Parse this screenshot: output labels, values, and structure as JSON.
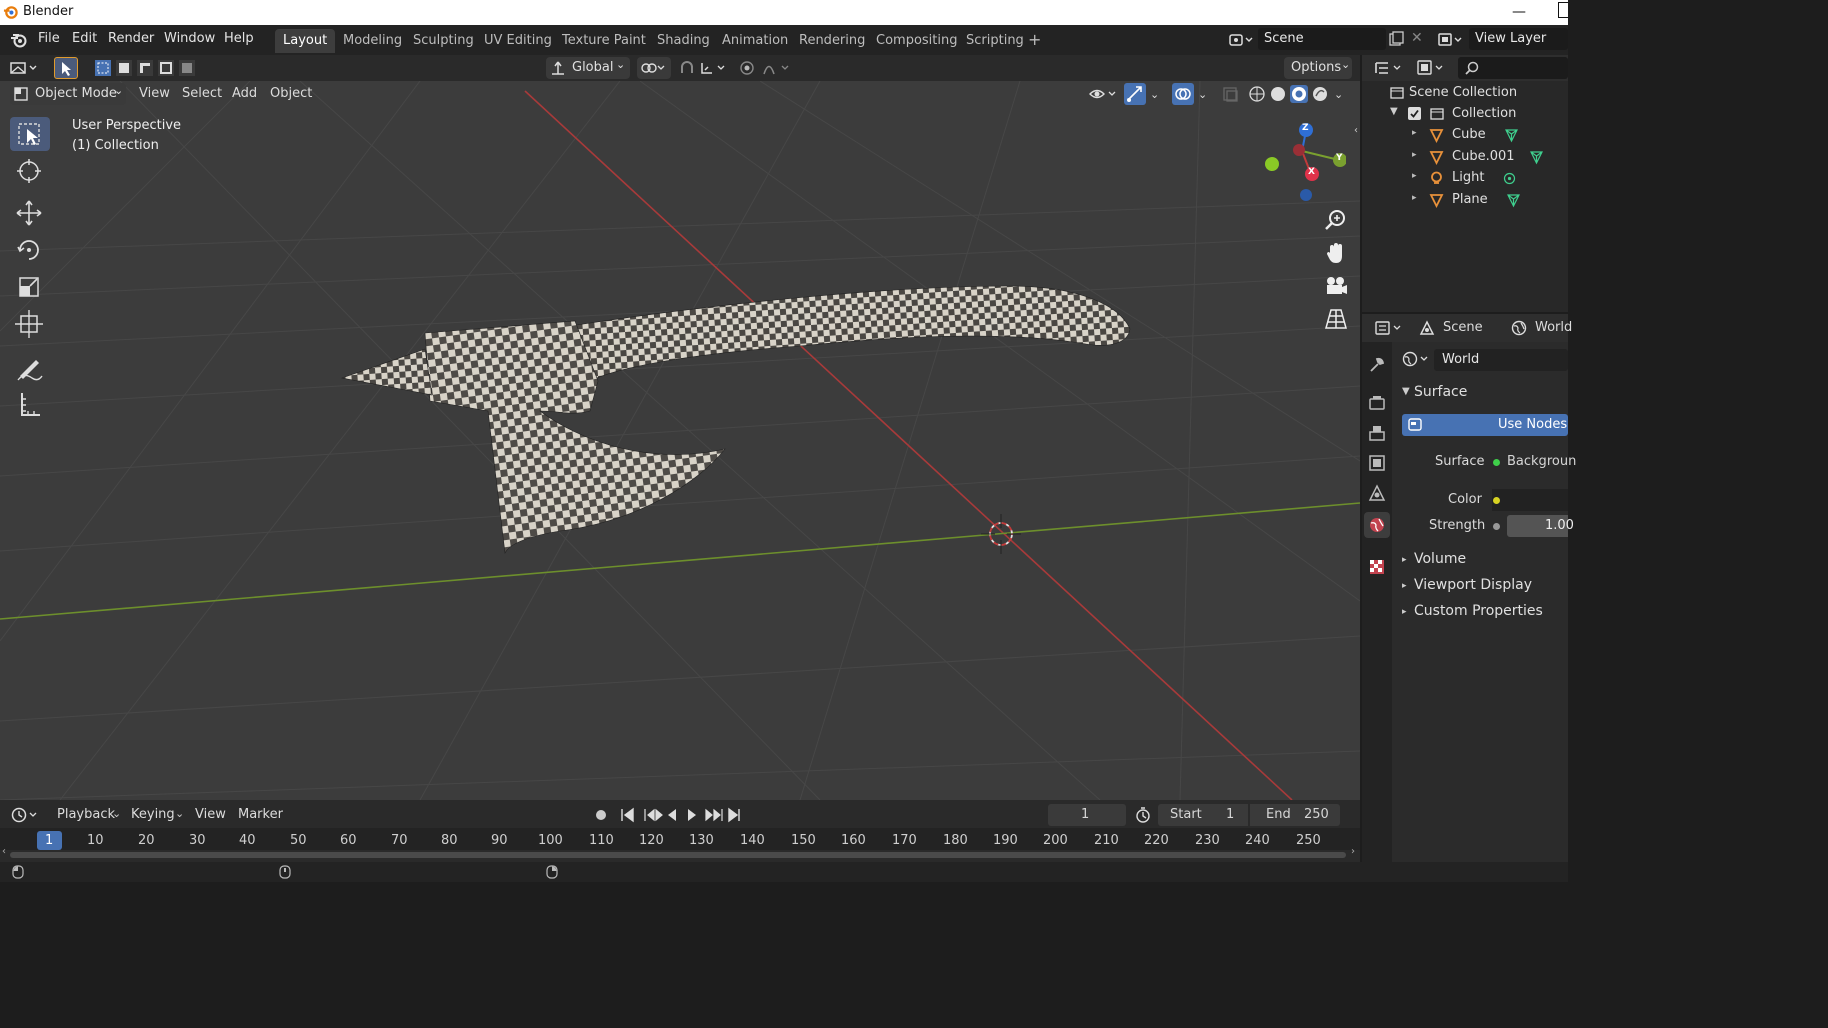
{
  "window": {
    "title": "Blender"
  },
  "menu": [
    "File",
    "Edit",
    "Render",
    "Window",
    "Help"
  ],
  "workspaces": [
    "Layout",
    "Modeling",
    "Sculpting",
    "UV Editing",
    "Texture Paint",
    "Shading",
    "Animation",
    "Rendering",
    "Compositing",
    "Scripting"
  ],
  "active_workspace": "Layout",
  "scene_name": "Scene",
  "view_layer": "View Layer",
  "tool_header": {
    "orientation": "Global",
    "options": "Options"
  },
  "viewport_header": {
    "mode": "Object Mode",
    "menus": [
      "View",
      "Select",
      "Add",
      "Object"
    ]
  },
  "viewport": {
    "perspective_label": "User Perspective",
    "collection_label": "(1) Collection"
  },
  "gizmo": {
    "z": "Z",
    "y": "Y",
    "x": "X"
  },
  "outliner": {
    "root": "Scene Collection",
    "collection": "Collection",
    "items": [
      "Cube",
      "Cube.001",
      "Light",
      "Plane"
    ]
  },
  "properties": {
    "breadcrumb_scene": "Scene",
    "breadcrumb_world": "World",
    "world_name": "World",
    "surface_section": "Surface",
    "use_nodes": "Use Nodes",
    "surface_label": "Surface",
    "surface_value": "Backgroun",
    "color_label": "Color",
    "strength_label": "Strength",
    "strength_value": "1.00",
    "volume_section": "Volume",
    "viewport_display_section": "Viewport Display",
    "custom_properties_section": "Custom Properties"
  },
  "timeline": {
    "menus": [
      "Playback",
      "Keying",
      "View",
      "Marker"
    ],
    "current_frame": "1",
    "start_label": "Start",
    "start_value": "1",
    "end_label": "End",
    "end_value": "250",
    "ticks": [
      "1",
      "10",
      "20",
      "30",
      "40",
      "50",
      "60",
      "70",
      "80",
      "90",
      "100",
      "110",
      "120",
      "130",
      "140",
      "150",
      "160",
      "170",
      "180",
      "190",
      "200",
      "210",
      "220",
      "230",
      "240",
      "250"
    ]
  },
  "colors": {
    "accent": "#4772b3",
    "x_axis": "#c23a3a",
    "y_axis": "#7aa02f",
    "z_axis": "#2f6fd6",
    "titlebar": "#ffffff"
  }
}
